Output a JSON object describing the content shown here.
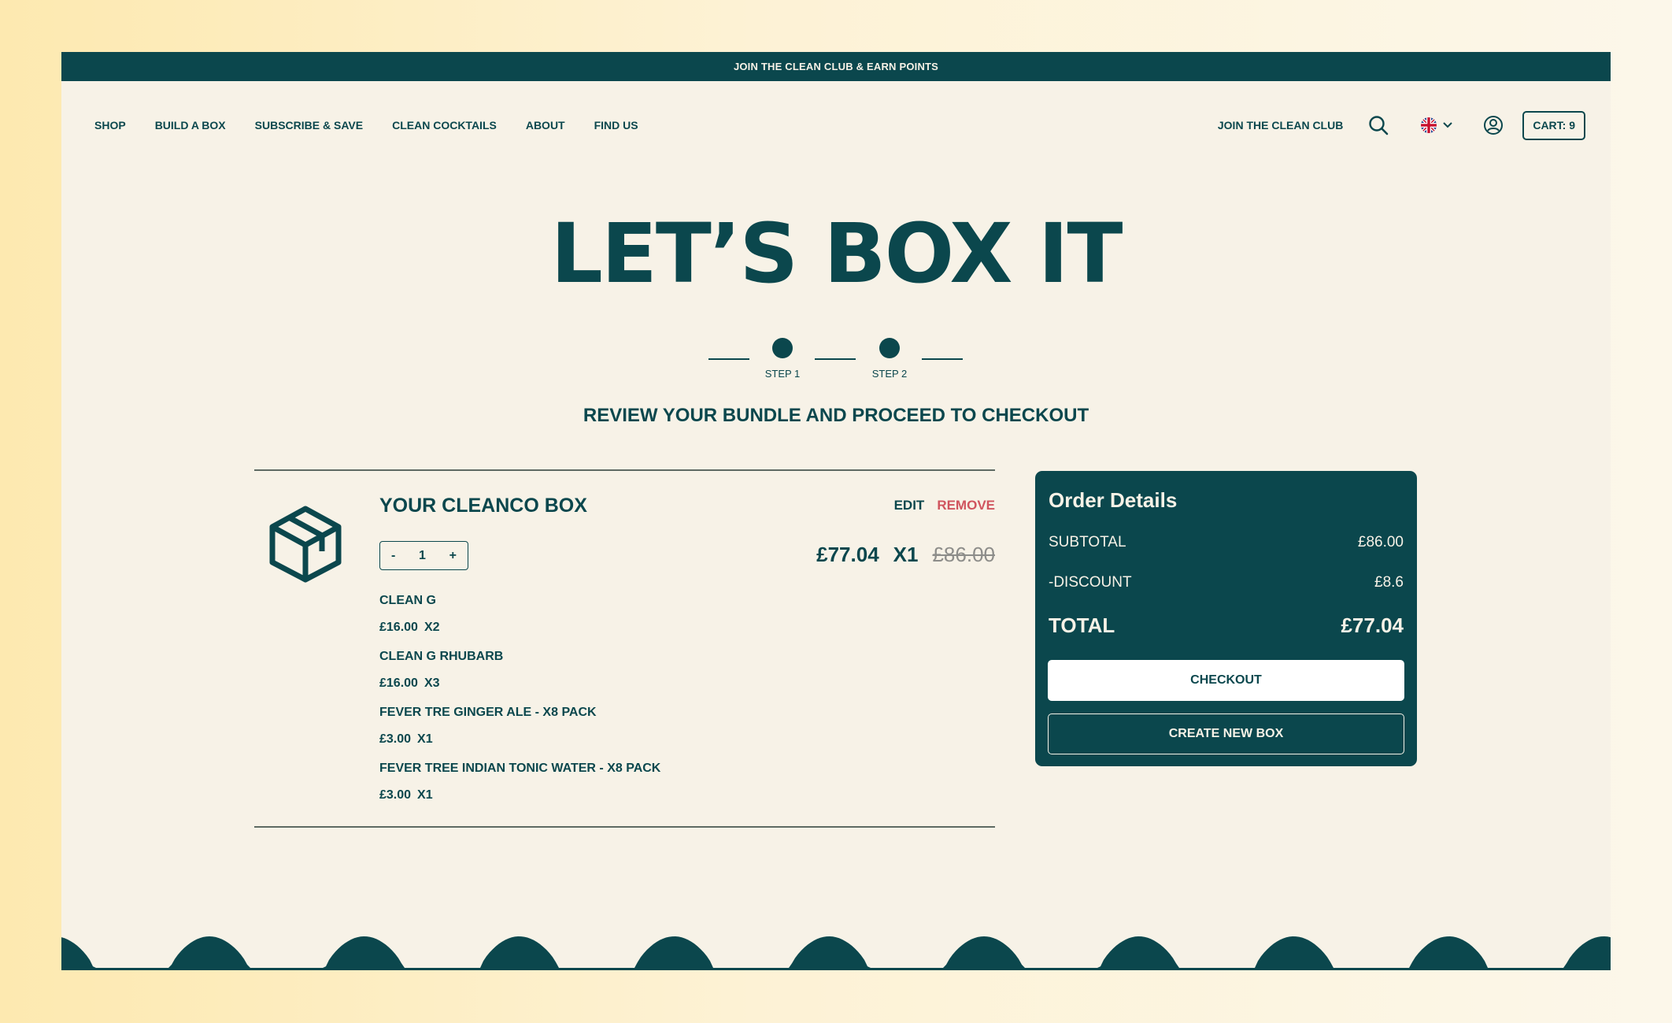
{
  "announcement": "JOIN THE CLEAN CLUB & EARN POINTS",
  "nav": {
    "links": [
      "SHOP",
      "BUILD A BOX",
      "SUBSCRIBE & SAVE",
      "CLEAN COCKTAILS",
      "ABOUT",
      "FIND US"
    ],
    "club_link": "JOIN THE CLEAN CLUB",
    "cart_label": "CART: 9"
  },
  "hero": {
    "title": "LET’S BOX IT",
    "steps": [
      "STEP 1",
      "STEP 2"
    ],
    "subtitle": "REVIEW YOUR BUNDLE AND PROCEED TO CHECKOUT"
  },
  "box": {
    "title": "YOUR CLEANCO BOX",
    "edit_label": "EDIT",
    "remove_label": "REMOVE",
    "quantity": {
      "minus": "-",
      "value": "1",
      "plus": "+"
    },
    "price": "£77.04",
    "multiplier": "X1",
    "original_price": "£86.00",
    "items": [
      {
        "name": "CLEAN G",
        "price": "£16.00",
        "qty": "X2"
      },
      {
        "name": "CLEAN G RHUBARB",
        "price": "£16.00",
        "qty": "X3"
      },
      {
        "name": "FEVER TRE GINGER ALE - X8 PACK",
        "price": "£3.00",
        "qty": "X1"
      },
      {
        "name": "FEVER TREE INDIAN TONIC WATER - X8 PACK",
        "price": "£3.00",
        "qty": "X1"
      }
    ]
  },
  "order": {
    "title": "Order Details",
    "subtotal_label": "SUBTOTAL",
    "subtotal_value": "£86.00",
    "discount_label": "-DISCOUNT",
    "discount_value": "£8.6",
    "total_label": "TOTAL",
    "total_value": "£77.04",
    "checkout_label": "CHECKOUT",
    "new_box_label": "CREATE NEW BOX"
  },
  "colors": {
    "brand": "#0b474d",
    "background": "#f7f2e7",
    "remove": "#d0545e"
  },
  "icons": {
    "search": "search-icon",
    "language": "uk-flag-icon",
    "account": "account-icon",
    "box": "box-icon"
  }
}
